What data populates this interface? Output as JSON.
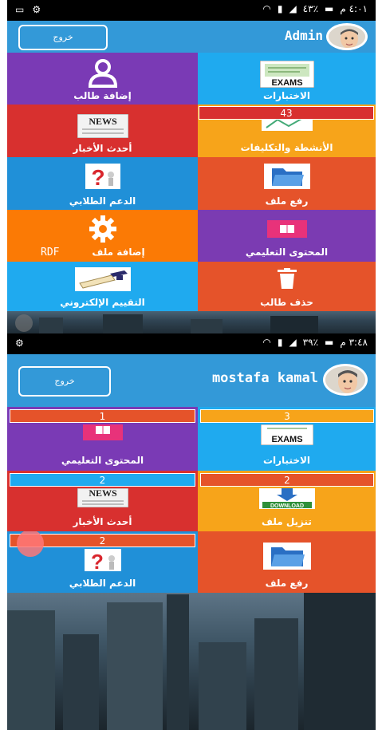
{
  "screen1": {
    "status": {
      "battery": "٤٣٪",
      "time": "٤:٠١ م"
    },
    "header": {
      "logout_label": "خروج",
      "username": "Admin"
    },
    "tiles": [
      {
        "id": "exams",
        "label": "الاختبارات",
        "icon": "exams-icon",
        "color": "#1faaef"
      },
      {
        "id": "add-student",
        "label": "إضافة طالب",
        "icon": "user-icon",
        "color": "#7a3ab5"
      },
      {
        "id": "activities",
        "label": "الأنشطة والتكليفات",
        "icon": "activities-icon",
        "color": "#f7a41a",
        "badge": "43"
      },
      {
        "id": "latest-news",
        "label": "أحدث الأخبار",
        "icon": "news-icon",
        "color": "#d8302f"
      },
      {
        "id": "upload-file",
        "label": "رفع ملف",
        "icon": "folder-icon",
        "color": "#e5532a"
      },
      {
        "id": "student-support",
        "label": "الدعم الطلابي",
        "icon": "question-icon",
        "color": "#2090d8"
      },
      {
        "id": "educational-content",
        "label": "المحتوى التعليمي",
        "icon": "book-icon",
        "color": "#7b3bb2"
      },
      {
        "id": "add-pdf",
        "label": "إضافة ملف",
        "label_extra": "RDF",
        "icon": "gear-icon",
        "color": "#fb7a05"
      },
      {
        "id": "delete-student",
        "label": "حذف طالب",
        "icon": "trash-icon",
        "color": "#e5532a"
      },
      {
        "id": "e-evaluation",
        "label": "التقييم الإلكتروني",
        "icon": "graduation-icon",
        "color": "#1faaef"
      }
    ]
  },
  "screen2": {
    "status": {
      "battery": "٣٩٪",
      "time": "٣:٤٨ م"
    },
    "header": {
      "logout_label": "خروج",
      "username": "mostafa kamal"
    },
    "tiles": [
      {
        "id": "exams",
        "label": "الاختبارات",
        "icon": "exams-icon",
        "color": "#1faaef",
        "badge": "3"
      },
      {
        "id": "educational-content",
        "label": "المحتوى التعليمي",
        "icon": "book-icon",
        "color": "#7a3ab5",
        "badge": "1"
      },
      {
        "id": "download-file",
        "label": "تنزيل ملف",
        "icon": "download-icon",
        "color": "#f7a41a",
        "badge": "2"
      },
      {
        "id": "latest-news",
        "label": "أحدث الأخبار",
        "icon": "news-icon",
        "color": "#d8302f",
        "badge": "2"
      },
      {
        "id": "upload-file",
        "label": "رفع ملف",
        "icon": "folder-icon",
        "color": "#e5532a"
      },
      {
        "id": "student-support",
        "label": "الدعم الطلابي",
        "icon": "question-icon",
        "color": "#2090d8",
        "badge": "2"
      }
    ]
  }
}
